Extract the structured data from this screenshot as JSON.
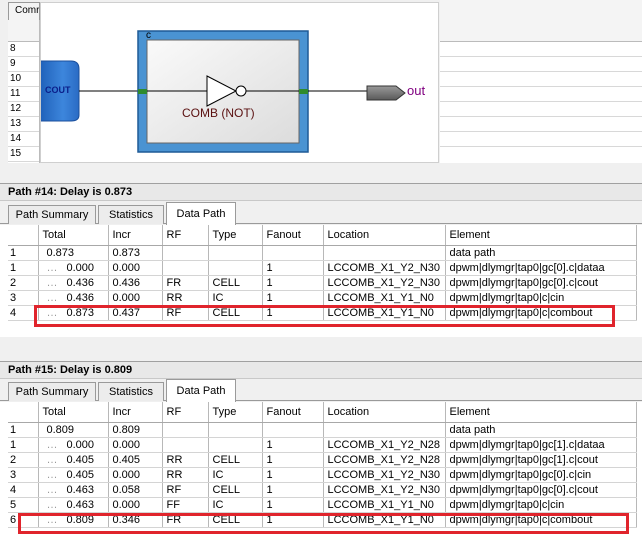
{
  "top_panel": {
    "tab_label": "Comr",
    "row_numbers": [
      "8",
      "9",
      "10",
      "11",
      "12",
      "13",
      "14",
      "15"
    ],
    "schematic": {
      "input_port": "COUT",
      "cell_name": "c",
      "gate_label": "COMB (NOT)",
      "output_port": "out"
    }
  },
  "columns": [
    "Total",
    "Incr",
    "RF",
    "Type",
    "Fanout",
    "Location",
    "Element"
  ],
  "tabs": [
    "Path Summary",
    "Statistics",
    "Data Path"
  ],
  "paths": [
    {
      "title": "Path #14: Delay is 0.873",
      "rows": [
        {
          "num": "1",
          "total": "0.873",
          "incr": "0.873",
          "rf": "",
          "type": "",
          "fanout": "",
          "location": "",
          "element": "data path",
          "sub": false
        },
        {
          "num": "1",
          "total": "0.000",
          "incr": "0.000",
          "rf": "",
          "type": "",
          "fanout": "1",
          "location": "LCCOMB_X1_Y2_N30",
          "element": "dpwm|dlymgr|tap0|gc[0].c|dataa",
          "sub": true
        },
        {
          "num": "2",
          "total": "0.436",
          "incr": "0.436",
          "rf": "FR",
          "type": "CELL",
          "fanout": "1",
          "location": "LCCOMB_X1_Y2_N30",
          "element": "dpwm|dlymgr|tap0|gc[0].c|cout",
          "sub": true
        },
        {
          "num": "3",
          "total": "0.436",
          "incr": "0.000",
          "rf": "RR",
          "type": "IC",
          "fanout": "1",
          "location": "LCCOMB_X1_Y1_N0",
          "element": "dpwm|dlymgr|tap0|c|cin",
          "sub": true
        },
        {
          "num": "4",
          "total": "0.873",
          "incr": "0.437",
          "rf": "RF",
          "type": "CELL",
          "fanout": "1",
          "location": "LCCOMB_X1_Y1_N0",
          "element": "dpwm|dlymgr|tap0|c|combout",
          "sub": true
        }
      ]
    },
    {
      "title": "Path #15: Delay is 0.809",
      "rows": [
        {
          "num": "1",
          "total": "0.809",
          "incr": "0.809",
          "rf": "",
          "type": "",
          "fanout": "",
          "location": "",
          "element": "data path",
          "sub": false
        },
        {
          "num": "1",
          "total": "0.000",
          "incr": "0.000",
          "rf": "",
          "type": "",
          "fanout": "1",
          "location": "LCCOMB_X1_Y2_N28",
          "element": "dpwm|dlymgr|tap0|gc[1].c|dataa",
          "sub": true
        },
        {
          "num": "2",
          "total": "0.405",
          "incr": "0.405",
          "rf": "RR",
          "type": "CELL",
          "fanout": "1",
          "location": "LCCOMB_X1_Y2_N28",
          "element": "dpwm|dlymgr|tap0|gc[1].c|cout",
          "sub": true
        },
        {
          "num": "3",
          "total": "0.405",
          "incr": "0.000",
          "rf": "RR",
          "type": "IC",
          "fanout": "1",
          "location": "LCCOMB_X1_Y2_N30",
          "element": "dpwm|dlymgr|tap0|gc[0].c|cin",
          "sub": true
        },
        {
          "num": "4",
          "total": "0.463",
          "incr": "0.058",
          "rf": "RF",
          "type": "CELL",
          "fanout": "1",
          "location": "LCCOMB_X1_Y2_N30",
          "element": "dpwm|dlymgr|tap0|gc[0].c|cout",
          "sub": true
        },
        {
          "num": "5",
          "total": "0.463",
          "incr": "0.000",
          "rf": "FF",
          "type": "IC",
          "fanout": "1",
          "location": "LCCOMB_X1_Y1_N0",
          "element": "dpwm|dlymgr|tap0|c|cin",
          "sub": true
        },
        {
          "num": "6",
          "total": "0.809",
          "incr": "0.346",
          "rf": "FR",
          "type": "CELL",
          "fanout": "1",
          "location": "LCCOMB_X1_Y1_N0",
          "element": "dpwm|dlymgr|tap0|c|combout",
          "sub": true
        }
      ]
    }
  ],
  "colors": {
    "highlight": "#e0242c",
    "port_blue": "#2f74d0",
    "cell_blue": "#4a93d2",
    "net_green": "#2e8b2e",
    "output_label": "#800080"
  }
}
